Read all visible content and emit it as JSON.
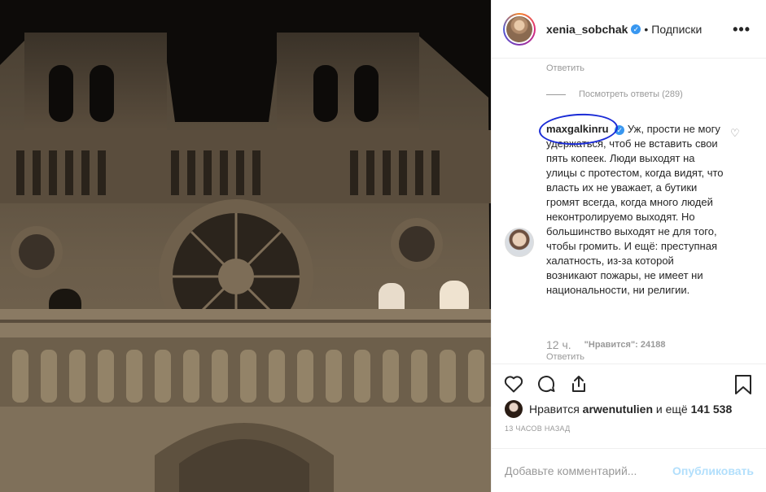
{
  "post": {
    "author": "xenia_sobchak",
    "author_verified_icon": "verified-badge-icon",
    "follow_label": "Подписки",
    "more_icon": "more-options-icon"
  },
  "comments": {
    "reply_top": "Ответить",
    "view_replies": "Посмотреть ответы (289)",
    "main_comment": {
      "user": "maxgalkinru",
      "text": "Уж, прости не могу удержаться, чтоб не вставить свои пять копеек. Люди выходят на улицы с протестом, когда видят, что власть их не уважает, а бутики громят всегда, когда много людей неконтролируемо выходят. Но большинство выходят не для того, чтобы громить. И ещё: преступная халатность, из-за которой возникают пожары, не имеет ни национальности, ни религии.",
      "time": "12 ч.",
      "likes": "\"Нравится\": 24188",
      "reply": "Ответить"
    }
  },
  "actions": {
    "like_icon": "heart-icon",
    "comment_icon": "comment-icon",
    "share_icon": "share-icon",
    "save_icon": "bookmark-icon"
  },
  "liked_by": {
    "prefix": "Нравится",
    "user": "arwenutulien",
    "suffix": "и ещё",
    "count": "141 538"
  },
  "timestamp": "13 ЧАСОВ НАЗАД",
  "comment_input": {
    "placeholder": "Добавьте комментарий...",
    "publish_label": "Опубликовать"
  },
  "colors": {
    "verified": "#3897f0",
    "publish_disabled": "#b2dffc",
    "annotation_circle": "#1a2bd6"
  }
}
